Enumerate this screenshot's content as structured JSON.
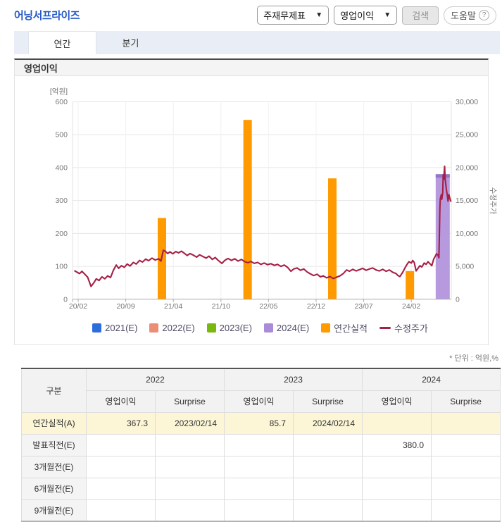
{
  "header": {
    "title": "어닝서프라이즈",
    "statement_select": "주재무제표",
    "metric_select": "영업이익",
    "search_label": "검색",
    "help_label": "도움말"
  },
  "tabs": [
    {
      "label": "연간",
      "active": true
    },
    {
      "label": "분기",
      "active": false
    }
  ],
  "section": {
    "title": "영업이익"
  },
  "chart_data": {
    "type": "combo-bar-line",
    "left_axis": {
      "unit_label": "[억원]",
      "ticks": [
        0,
        100,
        200,
        300,
        400,
        500,
        600
      ],
      "max": 600
    },
    "right_axis": {
      "label": "수정주가",
      "ticks": [
        0,
        5000,
        10000,
        15000,
        20000,
        25000,
        30000
      ],
      "max": 30000
    },
    "x_tick_labels": [
      "20/02",
      "20/09",
      "21/04",
      "21/10",
      "22/05",
      "22/12",
      "23/07",
      "24/02"
    ],
    "bars": [
      {
        "series": "연간실적",
        "t": 1.76,
        "value": 247,
        "width": 12
      },
      {
        "series": "연간실적",
        "t": 3.56,
        "value": 545,
        "width": 12
      },
      {
        "series": "연간실적",
        "t": 5.34,
        "value": 367.3,
        "width": 12
      },
      {
        "series": "연간실적",
        "t": 6.97,
        "value": 85.7,
        "width": 12
      },
      {
        "series": "2024(E)",
        "t": 7.66,
        "value": 380.0,
        "width": 20,
        "cap": true
      }
    ],
    "colors": {
      "annual_bar": "#ff9a00",
      "estimate_bar": "#b79ade",
      "estimate_cap": "#9474cc",
      "price_line": "#a52045",
      "grid": "#e6e6e6",
      "vgrid": "#f0f0f0",
      "axis": "#aaaaaa",
      "tick_text": "#777777"
    },
    "line_points": [
      [
        -0.07,
        4300
      ],
      [
        0.03,
        3900
      ],
      [
        0.08,
        4250
      ],
      [
        0.14,
        3800
      ],
      [
        0.2,
        3350
      ],
      [
        0.27,
        1950
      ],
      [
        0.33,
        2500
      ],
      [
        0.38,
        3100
      ],
      [
        0.44,
        2850
      ],
      [
        0.5,
        3400
      ],
      [
        0.56,
        3100
      ],
      [
        0.62,
        3550
      ],
      [
        0.68,
        3300
      ],
      [
        0.74,
        4400
      ],
      [
        0.8,
        5200
      ],
      [
        0.85,
        4700
      ],
      [
        0.91,
        5100
      ],
      [
        0.97,
        4850
      ],
      [
        1.03,
        5350
      ],
      [
        1.09,
        5050
      ],
      [
        1.16,
        5600
      ],
      [
        1.22,
        5350
      ],
      [
        1.29,
        5900
      ],
      [
        1.35,
        5650
      ],
      [
        1.42,
        6100
      ],
      [
        1.48,
        5850
      ],
      [
        1.55,
        6250
      ],
      [
        1.62,
        5950
      ],
      [
        1.69,
        6150
      ],
      [
        1.74,
        5800
      ],
      [
        1.79,
        7450
      ],
      [
        1.83,
        7300
      ],
      [
        1.88,
        6950
      ],
      [
        1.93,
        7200
      ],
      [
        1.99,
        6900
      ],
      [
        2.05,
        7250
      ],
      [
        2.11,
        7050
      ],
      [
        2.17,
        7300
      ],
      [
        2.23,
        7000
      ],
      [
        2.29,
        6650
      ],
      [
        2.35,
        6950
      ],
      [
        2.42,
        6700
      ],
      [
        2.49,
        6400
      ],
      [
        2.55,
        6750
      ],
      [
        2.62,
        6500
      ],
      [
        2.69,
        6250
      ],
      [
        2.75,
        6550
      ],
      [
        2.82,
        6050
      ],
      [
        2.88,
        6350
      ],
      [
        2.95,
        5850
      ],
      [
        3.02,
        5450
      ],
      [
        3.08,
        5900
      ],
      [
        3.15,
        6200
      ],
      [
        3.22,
        5900
      ],
      [
        3.29,
        6150
      ],
      [
        3.36,
        5800
      ],
      [
        3.43,
        6050
      ],
      [
        3.5,
        5700
      ],
      [
        3.57,
        5550
      ],
      [
        3.63,
        5750
      ],
      [
        3.7,
        5450
      ],
      [
        3.77,
        5600
      ],
      [
        3.84,
        5300
      ],
      [
        3.91,
        5500
      ],
      [
        3.98,
        5250
      ],
      [
        4.05,
        5400
      ],
      [
        4.12,
        5150
      ],
      [
        4.19,
        5300
      ],
      [
        4.26,
        5000
      ],
      [
        4.33,
        5200
      ],
      [
        4.4,
        4850
      ],
      [
        4.47,
        4250
      ],
      [
        4.53,
        4600
      ],
      [
        4.6,
        4750
      ],
      [
        4.67,
        4400
      ],
      [
        4.74,
        4600
      ],
      [
        4.81,
        4150
      ],
      [
        4.88,
        3850
      ],
      [
        4.95,
        3600
      ],
      [
        5.02,
        3800
      ],
      [
        5.09,
        3400
      ],
      [
        5.15,
        3550
      ],
      [
        5.22,
        3250
      ],
      [
        5.29,
        3450
      ],
      [
        5.36,
        3150
      ],
      [
        5.43,
        3350
      ],
      [
        5.5,
        3550
      ],
      [
        5.57,
        3900
      ],
      [
        5.64,
        4450
      ],
      [
        5.7,
        4250
      ],
      [
        5.77,
        4550
      ],
      [
        5.84,
        4300
      ],
      [
        5.91,
        4500
      ],
      [
        5.98,
        4700
      ],
      [
        6.05,
        4400
      ],
      [
        6.12,
        4600
      ],
      [
        6.19,
        4750
      ],
      [
        6.26,
        4450
      ],
      [
        6.33,
        4300
      ],
      [
        6.4,
        4550
      ],
      [
        6.47,
        4250
      ],
      [
        6.54,
        4450
      ],
      [
        6.61,
        4100
      ],
      [
        6.68,
        3900
      ],
      [
        6.72,
        3600
      ],
      [
        6.76,
        3450
      ],
      [
        6.82,
        4100
      ],
      [
        6.87,
        4800
      ],
      [
        6.91,
        5300
      ],
      [
        6.95,
        5700
      ],
      [
        7.0,
        5500
      ],
      [
        7.03,
        5900
      ],
      [
        7.06,
        5600
      ],
      [
        7.1,
        4300
      ],
      [
        7.14,
        4700
      ],
      [
        7.18,
        5100
      ],
      [
        7.22,
        4900
      ],
      [
        7.27,
        5500
      ],
      [
        7.31,
        5300
      ],
      [
        7.35,
        5700
      ],
      [
        7.39,
        5400
      ],
      [
        7.43,
        5100
      ],
      [
        7.47,
        6100
      ],
      [
        7.5,
        6500
      ],
      [
        7.53,
        6900
      ],
      [
        7.56,
        6700
      ],
      [
        7.58,
        6300
      ],
      [
        7.6,
        13900
      ],
      [
        7.61,
        15300
      ],
      [
        7.63,
        15900
      ],
      [
        7.64,
        15200
      ],
      [
        7.66,
        16200
      ],
      [
        7.67,
        18900
      ],
      [
        7.68,
        18200
      ],
      [
        7.7,
        20200
      ],
      [
        7.71,
        18400
      ],
      [
        7.72,
        17700
      ],
      [
        7.74,
        16500
      ],
      [
        7.76,
        15600
      ],
      [
        7.77,
        14900
      ],
      [
        7.79,
        15900
      ],
      [
        7.81,
        15300
      ],
      [
        7.83,
        14900
      ]
    ],
    "legend": [
      {
        "label": "2021(E)",
        "color": "#2c6fdc",
        "type": "box"
      },
      {
        "label": "2022(E)",
        "color": "#ea8e76",
        "type": "box"
      },
      {
        "label": "2023(E)",
        "color": "#79b80e",
        "type": "box"
      },
      {
        "label": "2024(E)",
        "color": "#a98bd8",
        "type": "box"
      },
      {
        "label": "연간실적",
        "color": "#ff9a00",
        "type": "box"
      },
      {
        "label": "수정주가",
        "color": "#a52045",
        "type": "line"
      }
    ]
  },
  "table": {
    "unit_note": "* 단위 : 억원,%",
    "corner_header": "구분",
    "year_groups": [
      "2022",
      "2023",
      "2024"
    ],
    "sub_headers": [
      "영업이익",
      "Surprise"
    ],
    "rows": [
      {
        "label": "연간실적(A)",
        "highlight": true,
        "cells": [
          "367.3",
          "2023/02/14",
          "85.7",
          "2024/02/14",
          "",
          ""
        ]
      },
      {
        "label": "발표직전(E)",
        "highlight": false,
        "cells": [
          "",
          "",
          "",
          "",
          "380.0",
          ""
        ]
      },
      {
        "label": "3개월전(E)",
        "highlight": false,
        "cells": [
          "",
          "",
          "",
          "",
          "",
          ""
        ]
      },
      {
        "label": "6개월전(E)",
        "highlight": false,
        "cells": [
          "",
          "",
          "",
          "",
          "",
          ""
        ]
      },
      {
        "label": "9개월전(E)",
        "highlight": false,
        "cells": [
          "",
          "",
          "",
          "",
          "",
          ""
        ]
      }
    ]
  }
}
